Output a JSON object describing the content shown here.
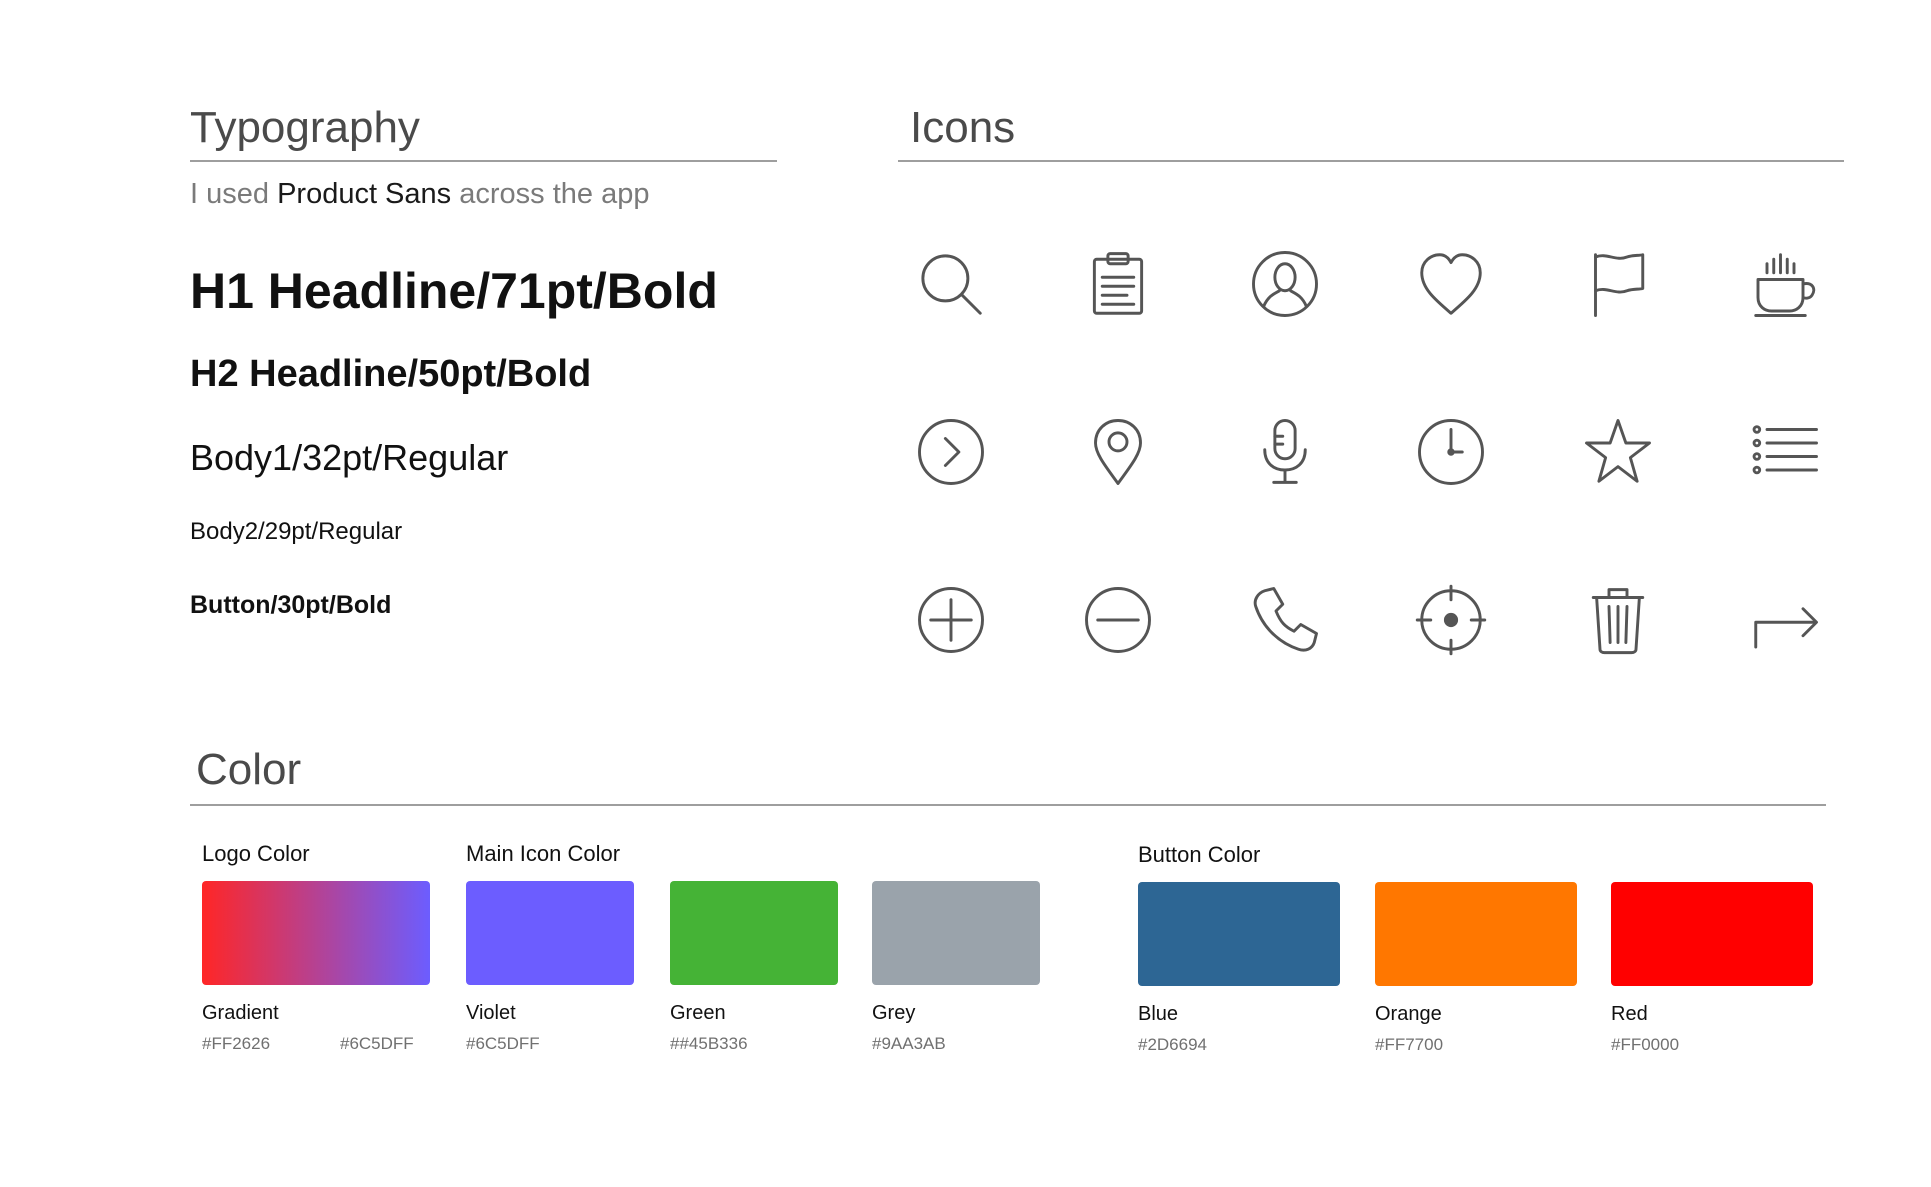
{
  "typography": {
    "title": "Typography",
    "subtitle_pre": "I used ",
    "subtitle_font": "Product Sans",
    "subtitle_post": " across the app",
    "samples": {
      "h1": "H1 Headline/71pt/Bold",
      "h2": "H2 Headline/50pt/Bold",
      "body1": "Body1/32pt/Regular",
      "body2": "Body2/29pt/Regular",
      "button": "Button/30pt/Bold"
    }
  },
  "icons": {
    "title": "Icons",
    "stroke_color": "#555555",
    "rows": [
      [
        "search-icon",
        "clipboard-icon",
        "user-icon",
        "heart-icon",
        "flag-icon",
        "coffee-icon"
      ],
      [
        "chevron-right-circle-icon",
        "location-pin-icon",
        "microphone-icon",
        "clock-icon",
        "star-icon",
        "list-icon"
      ],
      [
        "plus-circle-icon",
        "minus-circle-icon",
        "phone-icon",
        "target-icon",
        "trash-icon",
        "forward-arrow-icon"
      ]
    ]
  },
  "color": {
    "title": "Color",
    "logo": {
      "label": "Logo Color",
      "name": "Gradient",
      "hex_start": "#FF2626",
      "hex_end": "#6C5DFF"
    },
    "main_icon": {
      "label": "Main Icon Color",
      "swatches": [
        {
          "name": "Violet",
          "hex": "#6C5DFF",
          "color": "#6C5DFF"
        },
        {
          "name": "Green",
          "hex": "##45B336",
          "color": "#45B336"
        },
        {
          "name": "Grey",
          "hex": "#9AA3AB",
          "color": "#9AA3AB"
        }
      ]
    },
    "button": {
      "label": "Button Color",
      "swatches": [
        {
          "name": "Blue",
          "hex": "#2D6694",
          "color": "#2D6694"
        },
        {
          "name": "Orange",
          "hex": "#FF7700",
          "color": "#FF7700"
        },
        {
          "name": "Red",
          "hex": "#FF0000",
          "color": "#FF0000"
        }
      ]
    }
  }
}
